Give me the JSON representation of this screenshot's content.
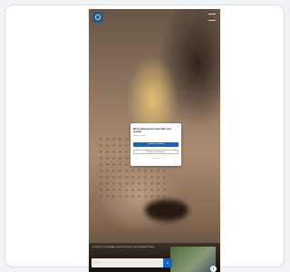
{
  "modal": {
    "title": "We've detected an issue with your prompt",
    "subtitle": "Please try again",
    "primary_label": "Continue to website",
    "secondary_label": "Return to search page",
    "link_label": "Learn more",
    "close_label": "×"
  },
  "footer": {
    "caption": "CLOSE-UP OF A HUMAN NOSE WITH SKIN TEXTURE AND PORES",
    "search_placeholder": "Search",
    "search_icon": "search-icon",
    "fab_icon": "chat-icon"
  },
  "colors": {
    "primary": "#1565c0",
    "card_border": "#d7dde6"
  }
}
